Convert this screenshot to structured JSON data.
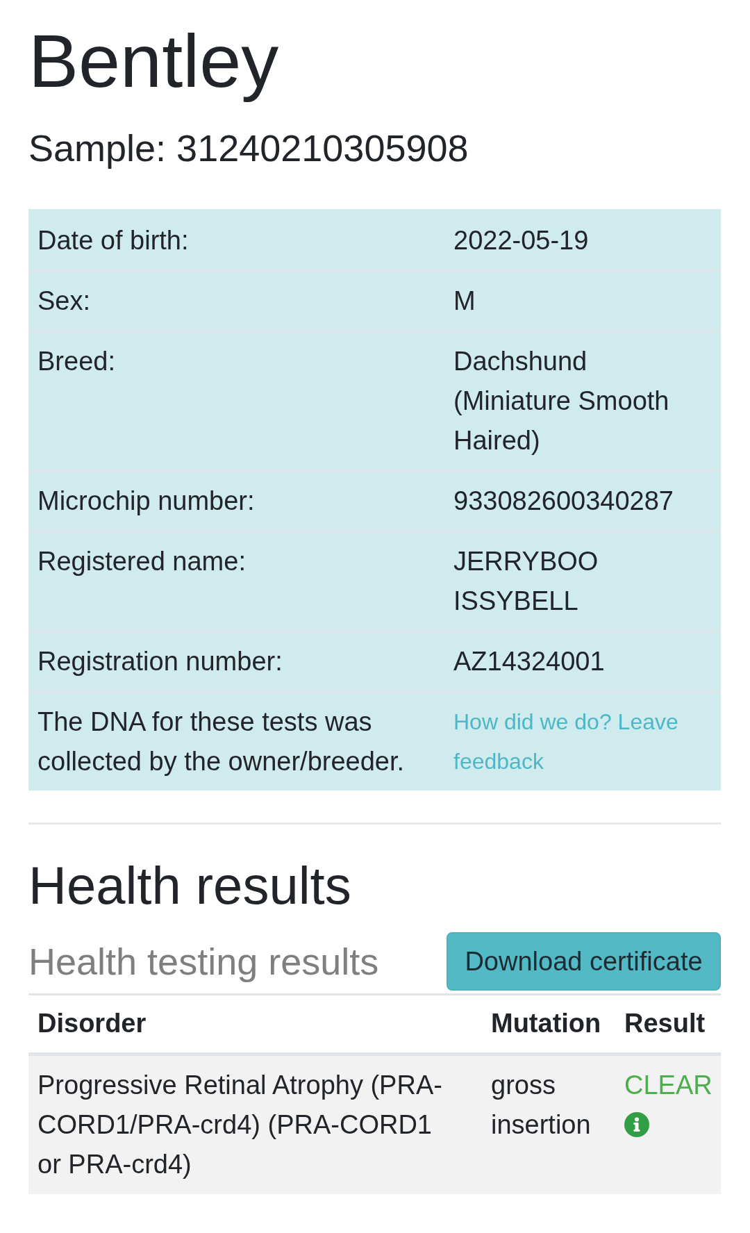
{
  "record": {
    "name": "Bentley",
    "sample": "Sample: 31240210305908"
  },
  "details": [
    {
      "kind": "text",
      "label": "Date of birth:",
      "value": "2022-05-19"
    },
    {
      "kind": "text",
      "label": "Sex:",
      "value": "M"
    },
    {
      "kind": "text",
      "label": "Breed:",
      "value": "Dachshund (Miniature Smooth Haired)"
    },
    {
      "kind": "text",
      "label": "Microchip number:",
      "value": "933082600340287"
    },
    {
      "kind": "text",
      "label": "Registered name:",
      "value": "JERRYBOO ISSYBELL"
    },
    {
      "kind": "text",
      "label": "Registration number:",
      "value": "AZ14324001"
    },
    {
      "kind": "link",
      "label": "The DNA for these tests was collected by the owner/breeder.",
      "value": "How did we do? Leave feedback"
    }
  ],
  "health": {
    "title": "Health results",
    "subtitle": "Health testing results",
    "download_button": "Download certificate"
  },
  "results_table": {
    "columns": [
      "Disorder",
      "Mutation",
      "Result"
    ],
    "rows": [
      {
        "disorder": "Progressive Retinal Atrophy (PRA-CORD1/PRA-crd4) (PRA-CORD1 or PRA-crd4)",
        "mutation": "gross insertion",
        "result": "CLEAR",
        "clear": true
      }
    ]
  }
}
